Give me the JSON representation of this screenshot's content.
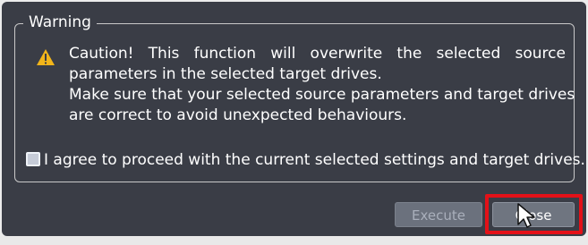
{
  "dialog": {
    "group_title": "Warning",
    "message_line_1_words": [
      "Caution!",
      "This",
      "function",
      "will",
      "overwrite",
      "the",
      "selected",
      "source"
    ],
    "message_line_2": "parameters in the selected target drives.",
    "message_line_3": "Make sure that your selected source parameters and target drives",
    "message_line_4": "are correct to avoid unexpected behaviours.",
    "agree_label": "I agree to proceed with the current selected settings and target drives.",
    "agree_checked": false
  },
  "buttons": {
    "execute_label": "Execute",
    "execute_enabled": false,
    "close_label": "Close"
  },
  "icons": {
    "warning": "warning-icon",
    "cursor": "mouse-pointer-icon"
  },
  "colors": {
    "dialog_background": "#3a3d46",
    "text": "#ffffff",
    "warning_icon": "#f2b51a",
    "highlight": "#e31118"
  }
}
